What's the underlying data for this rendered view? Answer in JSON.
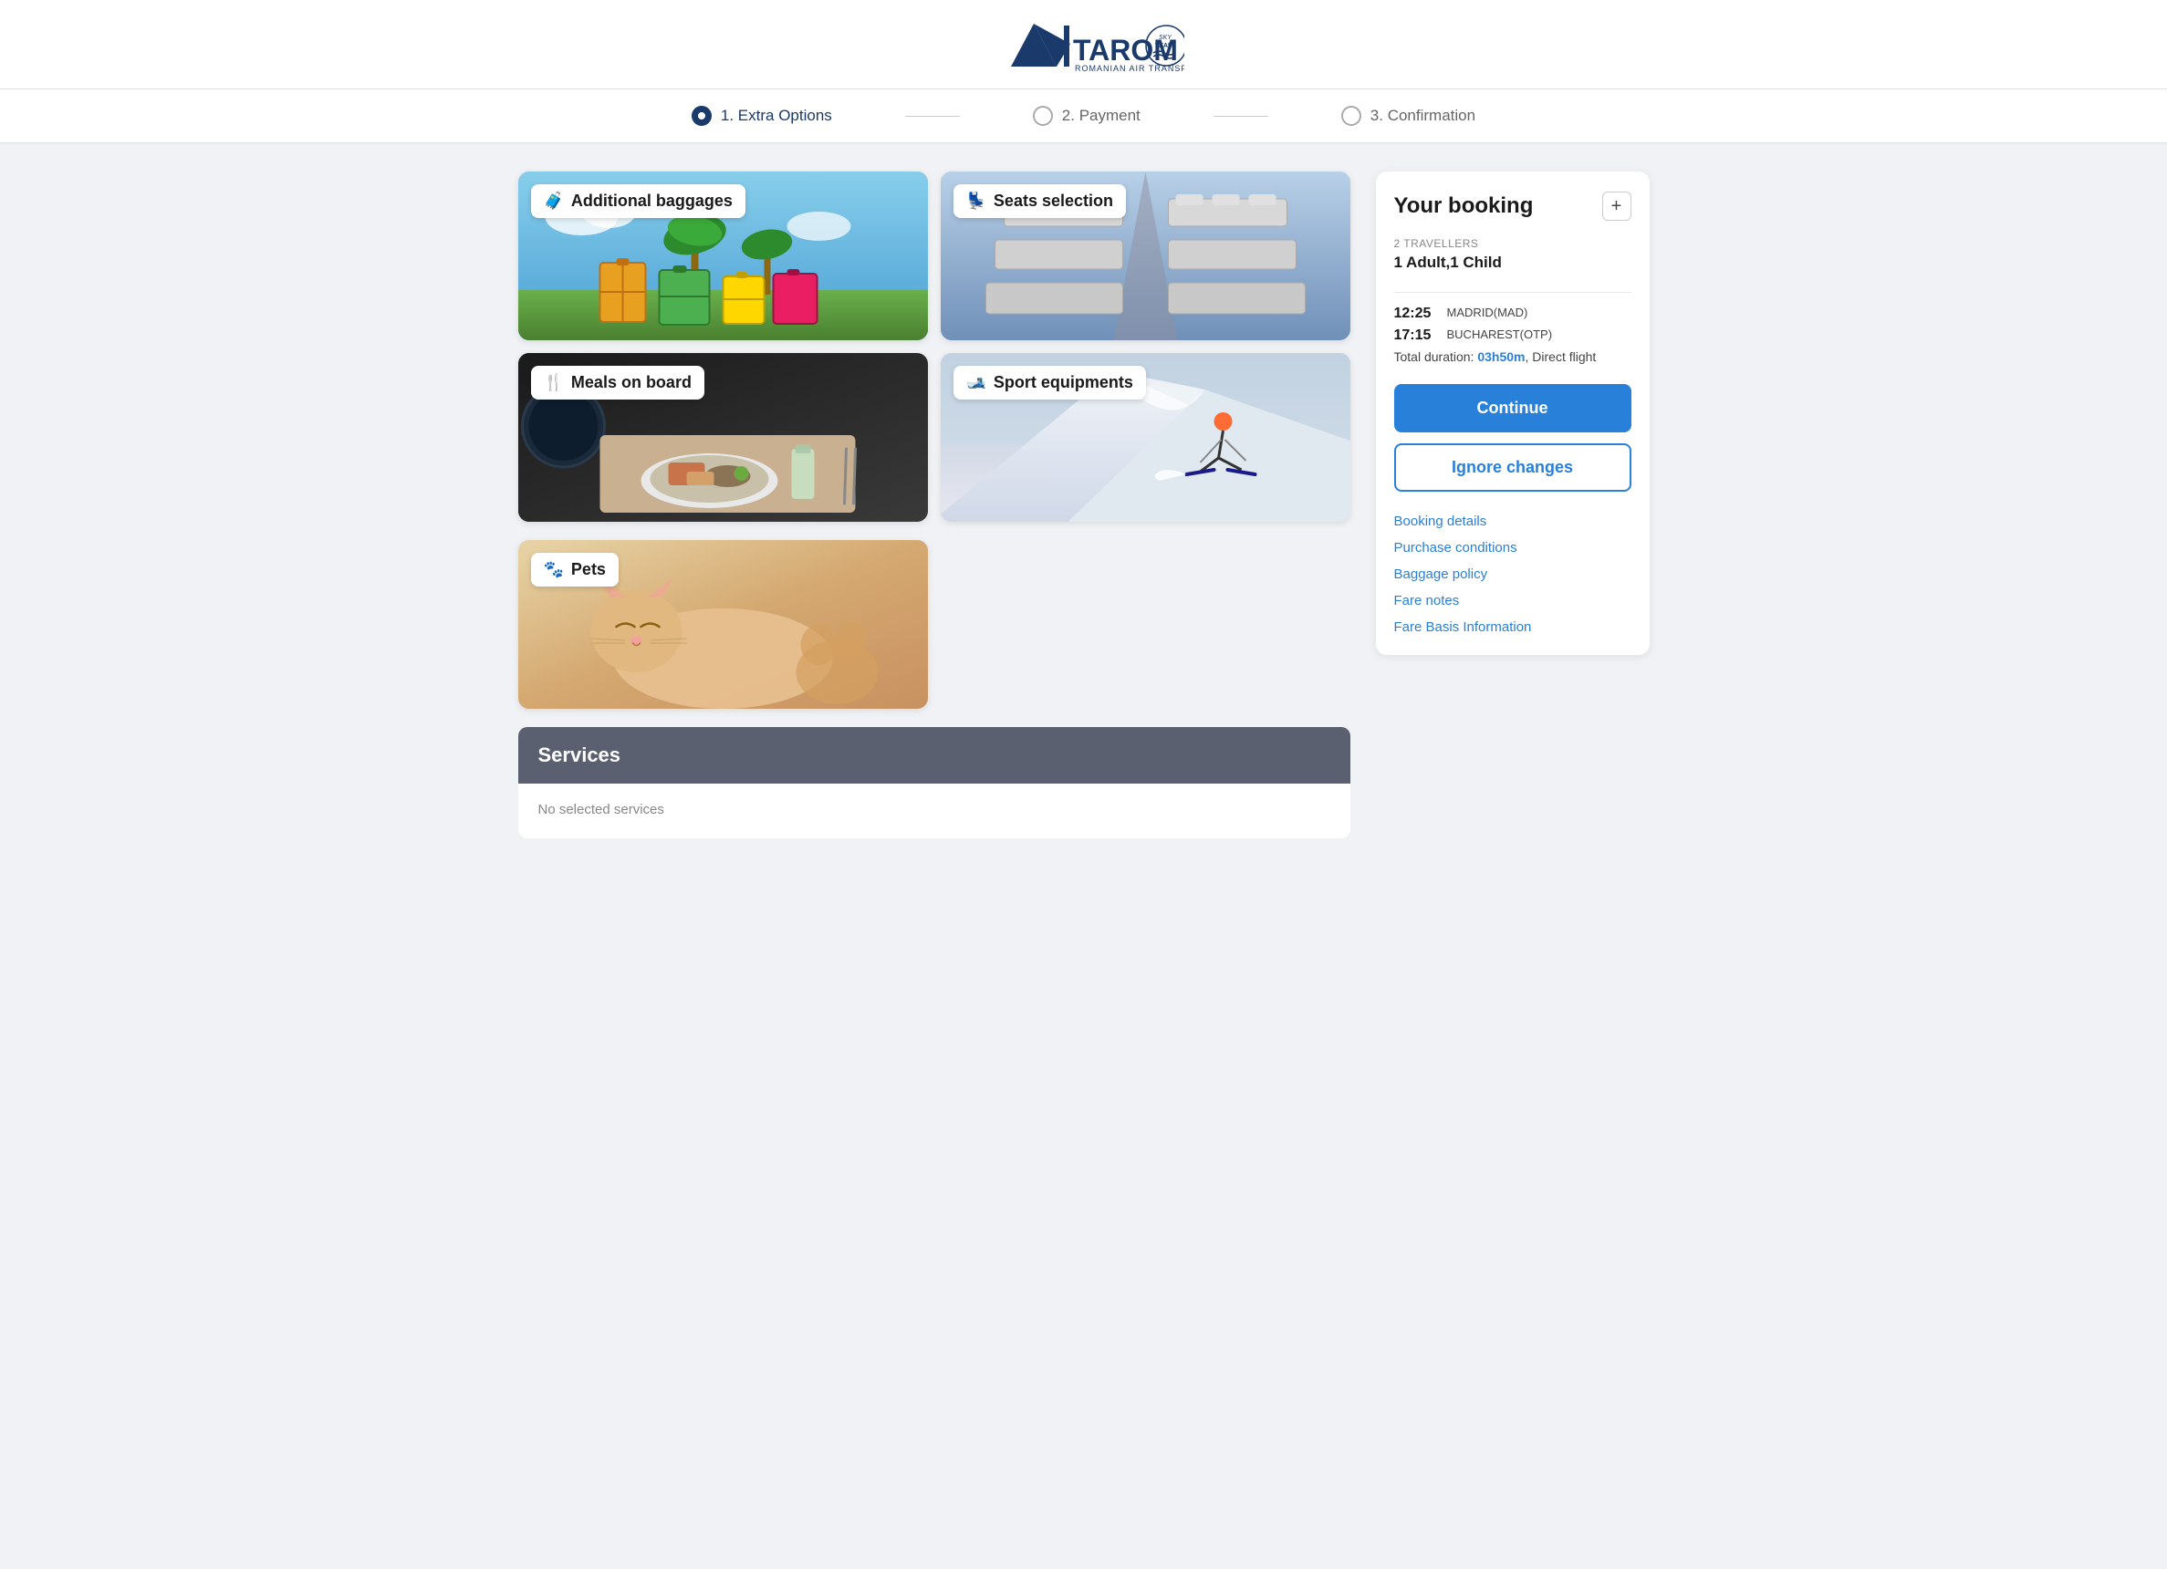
{
  "header": {
    "logo_alt": "TAROM Romanian Air Transport - SkyTeam"
  },
  "steps": {
    "step1": {
      "label": "1. Extra Options",
      "active": true
    },
    "step2": {
      "label": "2. Payment",
      "active": false
    },
    "step3": {
      "label": "3. Confirmation",
      "active": false
    }
  },
  "options": [
    {
      "id": "additional-baggages",
      "label": "Additional baggages",
      "icon": "🧳",
      "bg_class": "bg-baggage"
    },
    {
      "id": "seats-selection",
      "label": "Seats selection",
      "icon": "💺",
      "bg_class": "bg-seats"
    },
    {
      "id": "meals-on-board",
      "label": "Meals on board",
      "icon": "🍴",
      "bg_class": "bg-meals"
    },
    {
      "id": "sport-equipments",
      "label": "Sport equipments",
      "icon": "🎿",
      "bg_class": "bg-sports"
    },
    {
      "id": "pets",
      "label": "Pets",
      "icon": "🐾",
      "bg_class": "bg-pets"
    }
  ],
  "services": {
    "title": "Services",
    "no_services_text": "No selected services"
  },
  "booking": {
    "title": "Your booking",
    "plus_icon": "+",
    "travellers_label": "2 TRAVELLERS",
    "travellers_value": "1 Adult,1 Child",
    "flight": {
      "departure_time": "12:25",
      "departure_airport": "MADRID(MAD)",
      "arrival_time": "17:15",
      "arrival_airport": "BUCHAREST(OTP)",
      "duration_label": "Total duration:",
      "duration_value": "03h50m",
      "duration_suffix": ", Direct flight"
    },
    "continue_label": "Continue",
    "ignore_label": "Ignore changes",
    "links": [
      {
        "id": "booking-details",
        "label": "Booking details"
      },
      {
        "id": "purchase-conditions",
        "label": "Purchase conditions"
      },
      {
        "id": "baggage-policy",
        "label": "Baggage policy"
      },
      {
        "id": "fare-notes",
        "label": "Fare notes"
      },
      {
        "id": "fare-basis-information",
        "label": "Fare Basis Information"
      }
    ]
  }
}
